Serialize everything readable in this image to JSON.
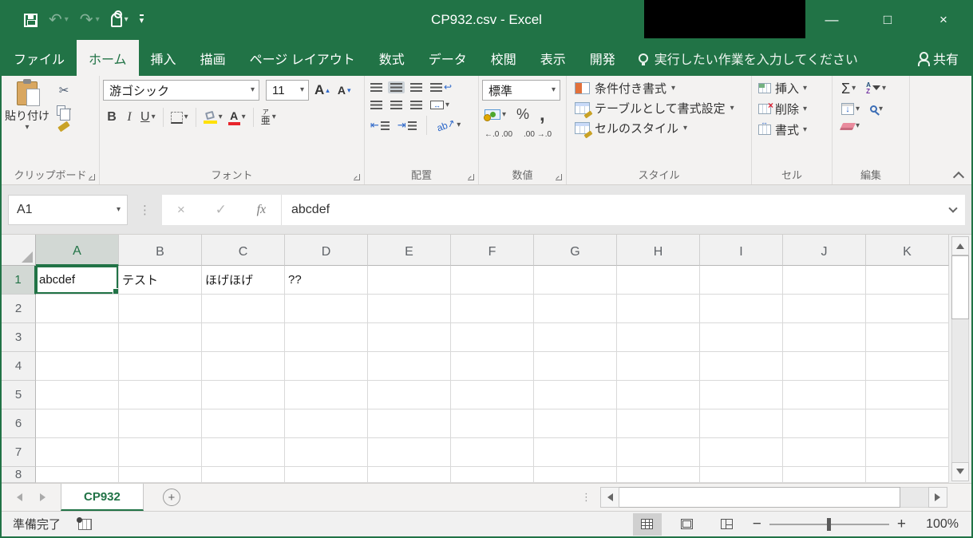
{
  "title_bar": {
    "title": "CP932.csv  -  Excel"
  },
  "window": {
    "minimize": "—",
    "maximize": "□",
    "close": "×"
  },
  "qat": {
    "undo": "↶",
    "redo": "↷"
  },
  "ui": {
    "dd": "▾",
    "grip": "⋮"
  },
  "tabs": [
    {
      "label": "ファイル"
    },
    {
      "label": "ホーム"
    },
    {
      "label": "挿入"
    },
    {
      "label": "描画"
    },
    {
      "label": "ページ レイアウト"
    },
    {
      "label": "数式"
    },
    {
      "label": "データ"
    },
    {
      "label": "校閲"
    },
    {
      "label": "表示"
    },
    {
      "label": "開発"
    }
  ],
  "tell_me": "実行したい作業を入力してください",
  "share_label": "共有",
  "ribbon": {
    "clipboard": {
      "label": "クリップボード",
      "paste": "貼り付け",
      "cut_glyph": "✂"
    },
    "font": {
      "label": "フォント",
      "name": "游ゴシック",
      "size": "11",
      "bold": "B",
      "italic": "I",
      "underline": "U",
      "grow": "A",
      "shrink": "A",
      "phonetic_top": "ア",
      "phonetic_bottom": "亜"
    },
    "alignment": {
      "label": "配置",
      "orientation": "ab↗",
      "wrap": "↩",
      "merge": "↔",
      "indent_dec": "⇤",
      "indent_inc": "⇥"
    },
    "number": {
      "label": "数値",
      "format": "標準",
      "percent": "%",
      "comma": ",",
      "inc_decimal": "←.0 .00",
      "dec_decimal": ".00 →.0"
    },
    "styles": {
      "label": "スタイル",
      "conditional": "条件付き書式",
      "table": "テーブルとして書式設定",
      "cell": "セルのスタイル"
    },
    "cells": {
      "label": "セル",
      "insert": "挿入",
      "delete": "削除",
      "format": "書式"
    },
    "editing": {
      "label": "編集",
      "sigma": "Σ",
      "sort_a": "A",
      "sort_z": "Z",
      "fill": "↓"
    }
  },
  "formula": {
    "name_box": "A1",
    "cancel": "×",
    "enter": "✓",
    "fx": "fx",
    "value": "abcdef"
  },
  "grid": {
    "columns": [
      "A",
      "B",
      "C",
      "D",
      "E",
      "F",
      "G",
      "H",
      "I",
      "J",
      "K"
    ],
    "rows": [
      "1",
      "2",
      "3",
      "4",
      "5",
      "6",
      "7",
      "8"
    ],
    "cells": {
      "A1": "abcdef",
      "B1": "テスト",
      "C1": "ほげほげ",
      "D1": "??"
    },
    "selected": "A1",
    "selected_col": "A",
    "selected_row": "1"
  },
  "sheet_bar": {
    "tab": "CP932",
    "new_sheet": "+"
  },
  "status_bar": {
    "ready": "準備完了",
    "zoom": "100%",
    "zoom_minus": "−",
    "zoom_plus": "+"
  },
  "colors": {
    "accent": "#217346",
    "fill_yellow": "#ffe100",
    "font_red": "#e8252b"
  }
}
